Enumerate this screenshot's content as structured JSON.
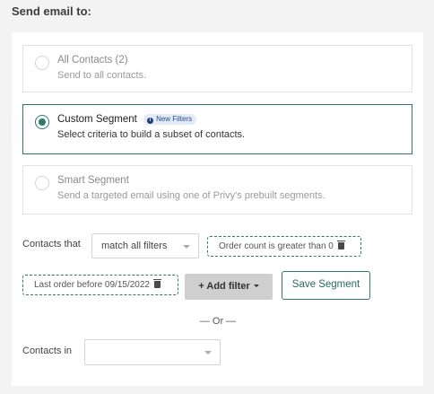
{
  "header": {
    "title": "Send email to:"
  },
  "options": [
    {
      "title": "All Contacts (2)",
      "description": "Send to all contacts.",
      "selected": false
    },
    {
      "title": "Custom Segment",
      "badge": "New Filters",
      "description": "Select criteria to build a subset of contacts.",
      "selected": true
    },
    {
      "title": "Smart Segment",
      "description": "Send a targeted email using one of Privy's prebuilt segments.",
      "selected": false
    }
  ],
  "filters": {
    "contacts_that_label": "Contacts that",
    "match_select_value": "match all filters",
    "filter_1": "Order count is greater than 0",
    "filter_2": "Last order before 09/15/2022",
    "add_filter_label": "+ Add filter",
    "save_segment_label": "Save Segment",
    "or_divider": "— Or —",
    "contacts_in_label": "Contacts in",
    "contacts_in_value": ""
  },
  "colors": {
    "accent": "#2f7a6a",
    "badge_bg": "#e3ebf7",
    "badge_text": "#2b4a8a",
    "add_filter_bg": "#cfcfcf"
  },
  "icons": [
    "info-icon",
    "trash-icon",
    "chevron-down-icon",
    "radio-icon"
  ]
}
